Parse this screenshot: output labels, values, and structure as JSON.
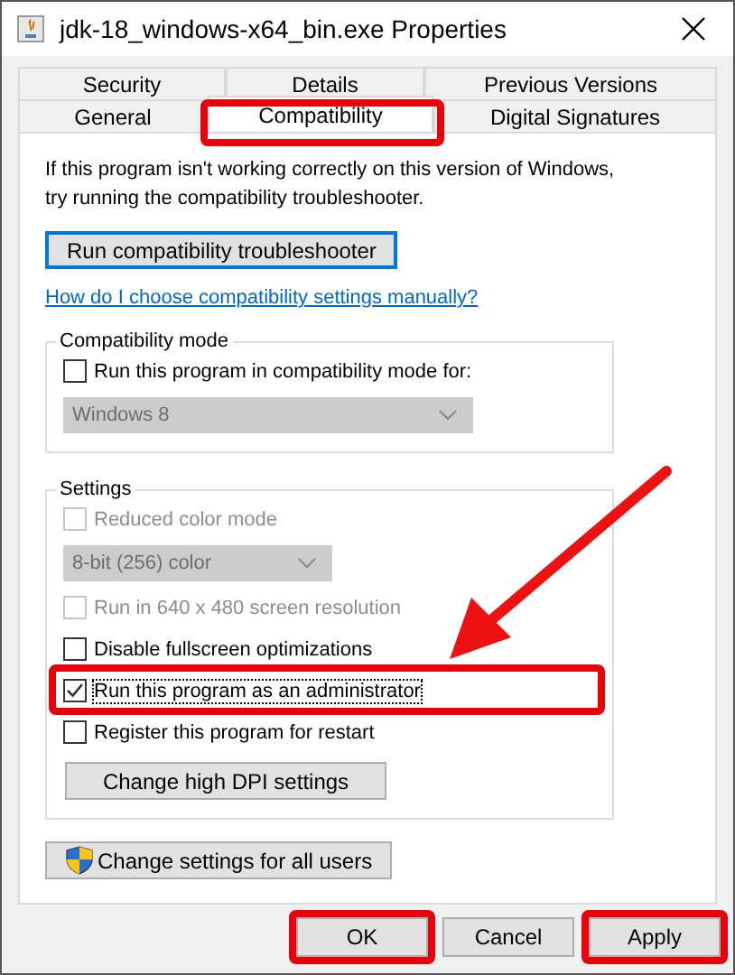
{
  "window": {
    "title": "jdk-18_windows-x64_bin.exe Properties"
  },
  "tab_rows": [
    [
      {
        "label": "Security",
        "selected": false,
        "highlighted": false
      },
      {
        "label": "Details",
        "selected": false,
        "highlighted": false
      },
      {
        "label": "Previous Versions",
        "selected": false,
        "highlighted": false
      }
    ],
    [
      {
        "label": "General",
        "selected": false,
        "highlighted": false
      },
      {
        "label": "Compatibility",
        "selected": true,
        "highlighted": true
      },
      {
        "label": "Digital Signatures",
        "selected": false,
        "highlighted": false
      }
    ]
  ],
  "intro_lines": [
    "If this program isn't working correctly on this version of Windows,",
    "try running the compatibility troubleshooter."
  ],
  "troubleshooter_button": {
    "label": "Run compatibility troubleshooter",
    "focused": true
  },
  "help_link": "How do I choose compatibility settings manually?",
  "compatibility_mode": {
    "title": "Compatibility mode",
    "items": [
      {
        "kind": "checkbox",
        "label": "Run this program in compatibility mode for:",
        "checked": false,
        "disabled": false,
        "focused": false,
        "highlighted": false
      },
      {
        "kind": "dropdown",
        "value": "Windows 8",
        "disabled": true
      }
    ]
  },
  "settings": {
    "title": "Settings",
    "items": [
      {
        "kind": "checkbox",
        "label": "Reduced color mode",
        "checked": false,
        "disabled": true,
        "focused": false,
        "highlighted": false
      },
      {
        "kind": "dropdown",
        "value": "8-bit (256) color",
        "disabled": true
      },
      {
        "kind": "checkbox",
        "label": "Run in 640 x 480 screen resolution",
        "checked": false,
        "disabled": true,
        "focused": false,
        "highlighted": false
      },
      {
        "kind": "checkbox",
        "label": "Disable fullscreen optimizations",
        "checked": false,
        "disabled": false,
        "focused": false,
        "highlighted": false
      },
      {
        "kind": "checkbox",
        "label": "Run this program as an administrator",
        "checked": true,
        "disabled": false,
        "focused": true,
        "highlighted": true
      },
      {
        "kind": "checkbox",
        "label": "Register this program for restart",
        "checked": false,
        "disabled": false,
        "focused": false,
        "highlighted": false
      },
      {
        "kind": "button",
        "label": "Change high DPI settings"
      }
    ]
  },
  "all_users_button": {
    "label": "Change settings for all users"
  },
  "dialog_buttons": [
    {
      "label": "OK",
      "highlighted": true
    },
    {
      "label": "Cancel",
      "highlighted": false
    },
    {
      "label": "Apply",
      "highlighted": true
    }
  ]
}
